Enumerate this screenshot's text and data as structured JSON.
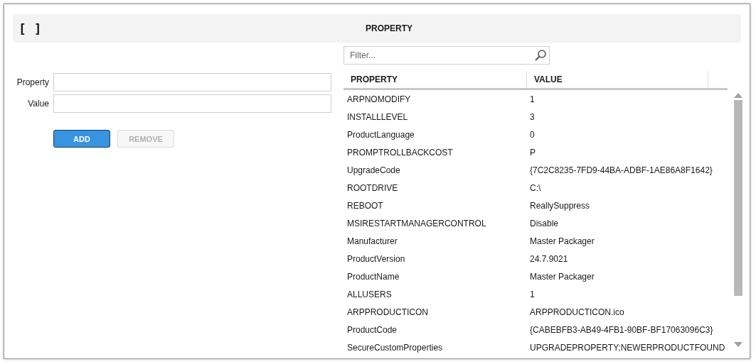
{
  "header": {
    "icon_text": "[ ]",
    "title": "PROPERTY"
  },
  "form": {
    "fields": [
      {
        "label": "Property"
      },
      {
        "label": "Value"
      }
    ],
    "buttons": [
      {
        "label": "ADD",
        "disabled": false
      },
      {
        "label": "REMOVE",
        "disabled": true
      }
    ]
  },
  "filter": {
    "placeholder": "Filter..."
  },
  "table": {
    "columns": [
      "PROPERTY",
      "VALUE"
    ],
    "rows": [
      {
        "property": "ARPNOMODIFY",
        "value": "1"
      },
      {
        "property": "INSTALLLEVEL",
        "value": "3"
      },
      {
        "property": "ProductLanguage",
        "value": "0"
      },
      {
        "property": "PROMPTROLLBACKCOST",
        "value": "P"
      },
      {
        "property": "UpgradeCode",
        "value": "{7C2C8235-7FD9-44BA-ADBF-1AE86A8F1642}"
      },
      {
        "property": "ROOTDRIVE",
        "value": "C:\\"
      },
      {
        "property": "REBOOT",
        "value": "ReallySuppress"
      },
      {
        "property": "MSIRESTARTMANAGERCONTROL",
        "value": "Disable"
      },
      {
        "property": "Manufacturer",
        "value": "Master Packager"
      },
      {
        "property": "ProductVersion",
        "value": "24.7.9021"
      },
      {
        "property": "ProductName",
        "value": "Master Packager"
      },
      {
        "property": "ALLUSERS",
        "value": "1"
      },
      {
        "property": "ARPPRODUCTICON",
        "value": "ARPPRODUCTICON.ico"
      },
      {
        "property": "ProductCode",
        "value": "{CABEBFB3-AB49-4FB1-90BF-BF17063096C3}"
      },
      {
        "property": "SecureCustomProperties",
        "value": "UPGRADEPROPERTY;NEWERPRODUCTFOUND"
      }
    ]
  }
}
